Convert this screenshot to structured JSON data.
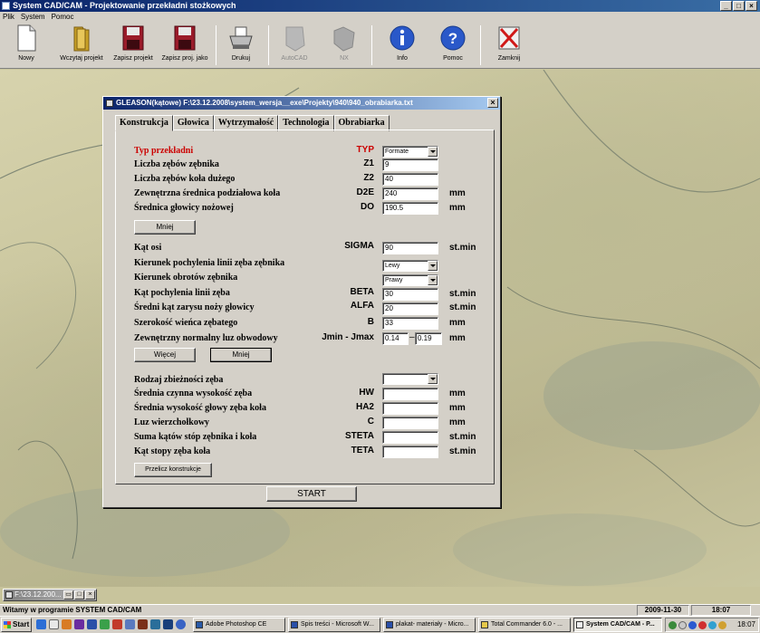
{
  "app": {
    "title": "System CAD/CAM - Projektowanie przekładni stożkowych",
    "window_buttons": [
      "_",
      "□",
      "×"
    ]
  },
  "menu": [
    "Plik",
    "System",
    "Pomoc"
  ],
  "toolbar": [
    {
      "label": "Nowy",
      "icon": "new-file-icon",
      "enabled": true
    },
    {
      "label": "Wczytaj projekt",
      "icon": "open-folder-icon",
      "enabled": true
    },
    {
      "label": "Zapisz projekt",
      "icon": "save-disk-icon",
      "enabled": true
    },
    {
      "label": "Zapisz proj. jako",
      "icon": "save-as-disk-icon",
      "enabled": true
    },
    {
      "label": "Drukuj",
      "icon": "printer-icon",
      "enabled": true
    },
    {
      "label": "AutoCAD",
      "icon": "autocad-icon",
      "enabled": false
    },
    {
      "label": "NX",
      "icon": "nx-icon",
      "enabled": false
    },
    {
      "label": "Info",
      "icon": "info-icon",
      "enabled": true
    },
    {
      "label": "Pomoc",
      "icon": "help-icon",
      "enabled": true
    },
    {
      "label": "Zamknij",
      "icon": "close-x-icon",
      "enabled": true
    }
  ],
  "dialog": {
    "title": "GLEASON(kątowe)  F:\\23.12.2008\\system_wersja__exe\\Projekty\\940\\940_obrabiarka.txt",
    "tabs": [
      "Konstrukcja",
      "Głowica",
      "Wytrzymałość",
      "Technologia",
      "Obrabiarka"
    ],
    "active_tab": "Konstrukcja",
    "fields": {
      "typ": {
        "label": "Typ przekładni",
        "symbol": "TYP",
        "value": "Formate"
      },
      "z1": {
        "label": "Liczba zębów zębnika",
        "symbol": "Z1",
        "value": "9"
      },
      "z2": {
        "label": "Liczba zębów koła dużego",
        "symbol": "Z2",
        "value": "40"
      },
      "d2e": {
        "label": "Zewnętrzna średnica podziałowa koła",
        "symbol": "D2E",
        "value": "240",
        "unit": "mm"
      },
      "do": {
        "label": "Średnica głowicy nożowej",
        "symbol": "DO",
        "value": "190.5",
        "unit": "mm"
      },
      "sigma": {
        "label": "Kąt osi",
        "symbol": "SIGMA",
        "value": "90",
        "unit": "st.min"
      },
      "kier_poch": {
        "label": "Kierunek pochylenia linii zęba zębnika",
        "value": "Lewy"
      },
      "kier_obr": {
        "label": "Kierunek obrotów zębnika",
        "value": "Prawy"
      },
      "beta": {
        "label": "Kąt pochylenia linii zęba",
        "symbol": "BETA",
        "value": "30",
        "unit": "st.min"
      },
      "alfa": {
        "label": "Średni kąt zarysu noży głowicy",
        "symbol": "ALFA",
        "value": "20",
        "unit": "st.min"
      },
      "b": {
        "label": "Szerokość wieńca zębatego",
        "symbol": "B",
        "value": "33",
        "unit": "mm"
      },
      "luz": {
        "label": "Zewnętrzny normalny luz obwodowy",
        "symbol": "Jmin - Jmax",
        "value_min": "0.14",
        "value_max": "0.19",
        "unit": "mm"
      },
      "zbiez": {
        "label": "Rodzaj zbieżności zęba",
        "value": ""
      },
      "hw": {
        "label": "Średnia czynna wysokość zęba",
        "symbol": "HW",
        "value": "",
        "unit": "mm"
      },
      "ha2": {
        "label": "Średnia wysokość głowy zęba koła",
        "symbol": "HA2",
        "value": "",
        "unit": "mm"
      },
      "c": {
        "label": "Luz wierzchołkowy",
        "symbol": "C",
        "value": "",
        "unit": "mm"
      },
      "steta": {
        "label": "Suma kątów stóp zębnika i koła",
        "symbol": "STETA",
        "value": "",
        "unit": "st.min"
      },
      "teta": {
        "label": "Kąt stopy zęba koła",
        "symbol": "TETA",
        "value": "",
        "unit": "st.min"
      }
    },
    "buttons": {
      "mniej1": "Mniej",
      "wiecej": "Więcej",
      "mniej2": "Mniej",
      "przelicz": "Przelicz konstrukcje",
      "start": "START"
    }
  },
  "minimized_window": {
    "title": "F:\\23.12.200..."
  },
  "statusbar": {
    "text": "Witamy w programie SYSTEM CAD/CAM",
    "date": "2009-11-30",
    "time": "18:07"
  },
  "taskbar": {
    "start_label": "Start",
    "tasks": [
      {
        "label": "Adobe Photoshop CE",
        "active": false
      },
      {
        "label": "Spis treści - Microsoft W...",
        "active": false
      },
      {
        "label": "plakat- materiały - Micro...",
        "active": false
      },
      {
        "label": "Total Commander 6.0 - ...",
        "active": false
      },
      {
        "label": "System CAD/CAM - P...",
        "active": true
      }
    ],
    "clock": "18:07"
  }
}
